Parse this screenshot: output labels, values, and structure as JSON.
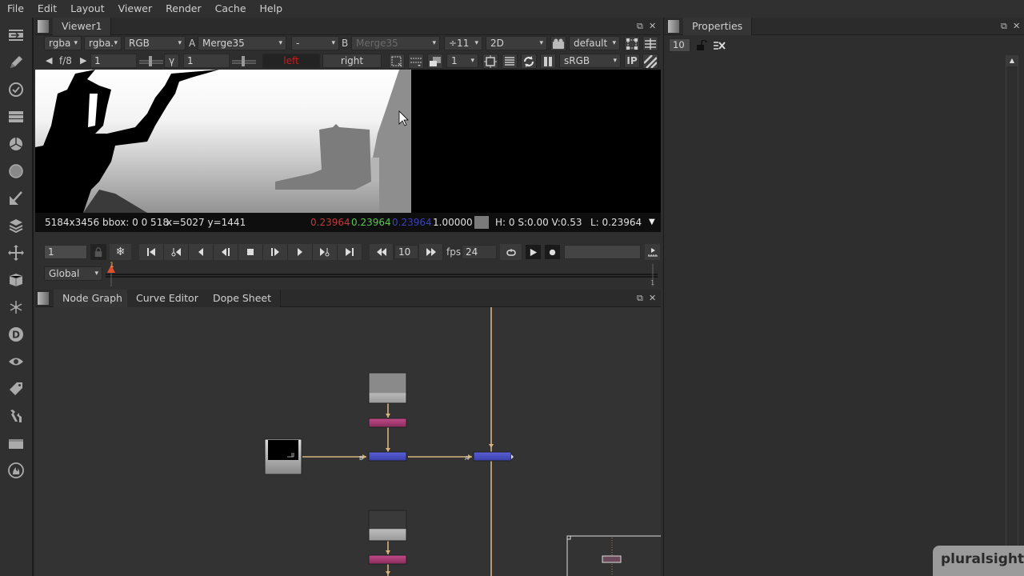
{
  "menubar": {
    "items": [
      "File",
      "Edit",
      "Layout",
      "Viewer",
      "Render",
      "Cache",
      "Help"
    ]
  },
  "left_toolbar": {
    "icons": [
      "image-read-icon",
      "draw-icon",
      "time-icon",
      "channel-icon",
      "color-icon",
      "filter-icon",
      "keyer-icon",
      "merge-icon",
      "transform-icon",
      "3d-icon",
      "particles-icon",
      "deep-icon",
      "views-icon",
      "metadata-icon",
      "toolsets-icon",
      "other-icon",
      "furnace-icon"
    ]
  },
  "viewer": {
    "tab_label": "Viewer1",
    "row1": {
      "channels": "rgba",
      "channel_layer": "rgba.",
      "display_channels": "RGB",
      "a_label": "A",
      "input_a": "Merge35",
      "operation": "-",
      "b_label": "B",
      "input_b": "Merge35",
      "downscale": "÷11",
      "view_mode": "2D",
      "lut": "default"
    },
    "row2": {
      "fstop": "f/8",
      "gain": "1",
      "gamma_label": "γ",
      "gamma": "1",
      "left_view": "left",
      "right_view": "right",
      "proxy_level": "1",
      "colorspace": "sRGB",
      "ip_label": "IP"
    },
    "info": {
      "format": "5184x3456 bbox: 0 0 518",
      "coords": "x=5027 y=1441",
      "r": "0.23964",
      "g": "0.23964",
      "b": "0.23964",
      "a": "1.00000",
      "hsv": "H:  0 S:0.00 V:0.53",
      "lum": "L: 0.23964",
      "swatch_color": "#7a7a7a"
    },
    "colors": {
      "r": "#c0393b",
      "g": "#59c84f",
      "b": "#3d42b8",
      "a": "#e0e0e0",
      "left_view": "#c81e1e"
    }
  },
  "transport": {
    "frame": "1",
    "step": "10",
    "fps_label": "fps",
    "fps": "24",
    "range_mode": "Global",
    "timeline_start": "1",
    "timeline_end": "1"
  },
  "nodegraph": {
    "tabs": [
      {
        "label": "Node Graph",
        "active": true
      },
      {
        "label": "Curve Editor",
        "active": false
      },
      {
        "label": "Dope Sheet",
        "active": false
      }
    ],
    "pipe_labels": {
      "b": "B",
      "a": "A"
    },
    "colors": {
      "pipe": "#d7b47e",
      "merge": "#4a4fc0",
      "grade": "#a83a72",
      "read_top": "#8a8a8a",
      "read_bottom": "#bcbcbc"
    }
  },
  "properties": {
    "tab_label": "Properties",
    "max_panels": "10"
  },
  "watermark": {
    "text": "pluralsight"
  }
}
